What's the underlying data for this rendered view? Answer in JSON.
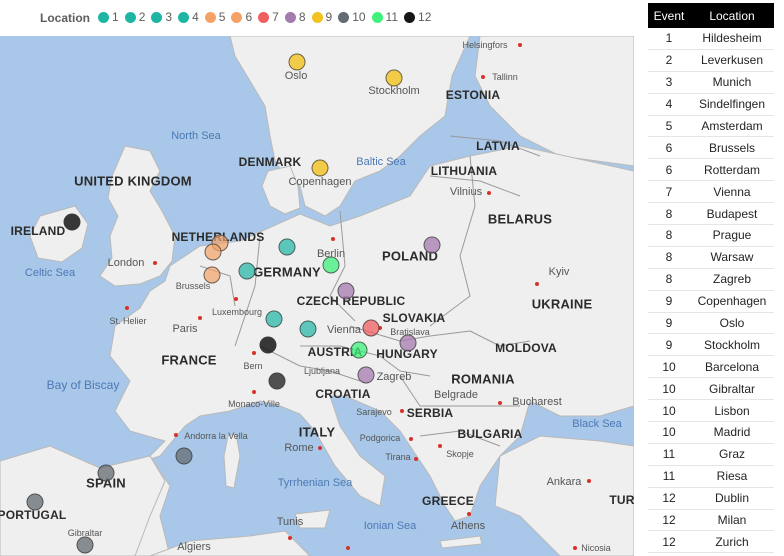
{
  "legend": {
    "title": "Location",
    "items": [
      {
        "label": "1",
        "color": "#1fb5a5"
      },
      {
        "label": "2",
        "color": "#1fb5a5"
      },
      {
        "label": "3",
        "color": "#1fb5a5"
      },
      {
        "label": "4",
        "color": "#1fb5a5"
      },
      {
        "label": "5",
        "color": "#f4a266"
      },
      {
        "label": "6",
        "color": "#f4a266"
      },
      {
        "label": "7",
        "color": "#f05f5f"
      },
      {
        "label": "8",
        "color": "#a57bae"
      },
      {
        "label": "9",
        "color": "#f2c21f"
      },
      {
        "label": "10",
        "color": "#646b72"
      },
      {
        "label": "11",
        "color": "#3ef27b"
      },
      {
        "label": "12",
        "color": "#161616"
      }
    ]
  },
  "map": {
    "countries": {
      "uk": "UNITED KINGDOM",
      "ireland": "IRELAND",
      "denmark": "DENMARK",
      "estonia": "ESTONIA",
      "latvia": "LATVIA",
      "lithuania": "LITHUANIA",
      "belarus": "BELARUS",
      "netherlands": "NETHERLANDS",
      "germany": "GERMANY",
      "poland": "POLAND",
      "czech": "CZECH REPUBLIC",
      "slovakia": "SLOVAKIA",
      "ukraine": "UKRAINE",
      "moldova": "MOLDOVA",
      "austria": "AUSTRIA",
      "hungary": "HUNGARY",
      "romania": "ROMANIA",
      "france": "FRANCE",
      "croatia": "CROATIA",
      "serbia": "SERBIA",
      "bulgaria": "BULGARIA",
      "italy": "ITALY",
      "spain": "SPAIN",
      "portugal": "PORTUGAL",
      "greece": "GREECE",
      "turkey": "TUR"
    },
    "cities": {
      "helsingfors": "Helsingfors",
      "tallinn": "Tallinn",
      "oslo": "Oslo",
      "stockholm": "Stockholm",
      "copenhagen": "Copenhagen",
      "vilnius": "Vilnius",
      "london": "London",
      "berlin": "Berlin",
      "brussels": "Brussels",
      "luxembourg": "Luxembourg",
      "kyiv": "Kyiv",
      "sthelier": "St. Helier",
      "paris": "Paris",
      "vienna": "Vienna",
      "bratislava": "Bratislava",
      "bern": "Bern",
      "ljubljana": "Ljubljana",
      "zagreb": "Zagreb",
      "belgrade": "Belgrade",
      "bucharest": "Bucharest",
      "monaco": "Monaco-Ville",
      "sarajevo": "Sarajevo",
      "andorra": "Andorra la Vella",
      "rome": "Rome",
      "podgorica": "Podgorica",
      "skopje": "Skopje",
      "tirana": "Tirana",
      "ankara": "Ankara",
      "athens": "Athens",
      "tunis": "Tunis",
      "gibraltar": "Gibraltar",
      "algiers": "Algiers",
      "nicosia": "Nicosia"
    },
    "waters": {
      "northsea": "North Sea",
      "balticsea": "Baltic Sea",
      "celticsea": "Celtic Sea",
      "biscay": "Bay of Biscay",
      "tyrrhenian": "Tyrrhenian Sea",
      "ionian": "Ionian Sea",
      "blacksea": "Black Sea"
    }
  },
  "table": {
    "headers": {
      "event": "Event",
      "location": "Location"
    },
    "rows": [
      {
        "event": "1",
        "location": "Hildesheim"
      },
      {
        "event": "2",
        "location": "Leverkusen"
      },
      {
        "event": "3",
        "location": "Munich"
      },
      {
        "event": "4",
        "location": "Sindelfingen"
      },
      {
        "event": "5",
        "location": "Amsterdam"
      },
      {
        "event": "6",
        "location": "Brussels"
      },
      {
        "event": "6",
        "location": "Rotterdam"
      },
      {
        "event": "7",
        "location": "Vienna"
      },
      {
        "event": "8",
        "location": "Budapest"
      },
      {
        "event": "8",
        "location": "Prague"
      },
      {
        "event": "8",
        "location": "Warsaw"
      },
      {
        "event": "8",
        "location": "Zagreb"
      },
      {
        "event": "9",
        "location": "Copenhagen"
      },
      {
        "event": "9",
        "location": "Oslo"
      },
      {
        "event": "9",
        "location": "Stockholm"
      },
      {
        "event": "10",
        "location": "Barcelona"
      },
      {
        "event": "10",
        "location": "Gibraltar"
      },
      {
        "event": "10",
        "location": "Lisbon"
      },
      {
        "event": "10",
        "location": "Madrid"
      },
      {
        "event": "11",
        "location": "Graz"
      },
      {
        "event": "11",
        "location": "Riesa"
      },
      {
        "event": "12",
        "location": "Dublin"
      },
      {
        "event": "12",
        "location": "Milan"
      },
      {
        "event": "12",
        "location": "Zurich"
      }
    ]
  }
}
